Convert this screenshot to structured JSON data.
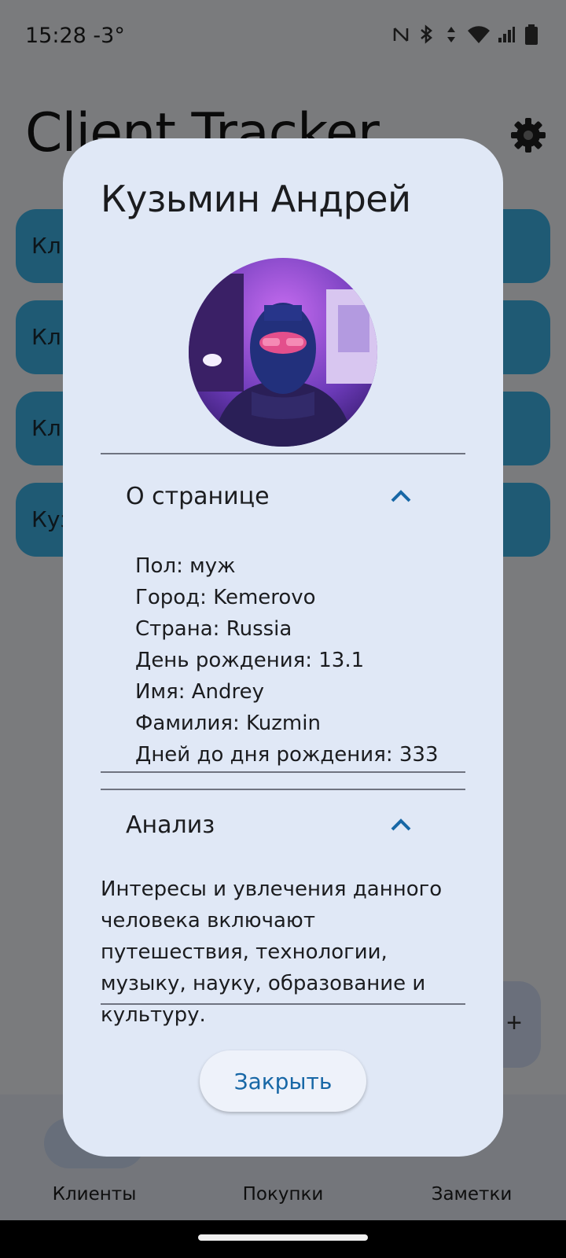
{
  "status": {
    "time": "15:28",
    "temperature": "-3°"
  },
  "app": {
    "title": "Client Tracker",
    "clients": [
      "Кли",
      "Кли",
      "Кли",
      "Куз"
    ]
  },
  "nav": {
    "items": [
      "Клиенты",
      "Покупки",
      "Заметки"
    ]
  },
  "dialog": {
    "title": "Кузьмин Андрей",
    "about": {
      "header": "О странице",
      "lines": [
        {
          "key": "Пол:",
          "value": "муж"
        },
        {
          "key": "Город:",
          "value": "Kemerovo"
        },
        {
          "key": "Страна:",
          "value": "Russia"
        },
        {
          "key": "День рождения:",
          "value": "13.1"
        },
        {
          "key": "Имя:",
          "value": "Andrey"
        },
        {
          "key": "Фамилия:",
          "value": "Kuzmin"
        },
        {
          "key": "Дней до дня рождения:",
          "value": "333"
        }
      ]
    },
    "analysis": {
      "header": "Анализ",
      "text": "Интересы и увлечения данного человека включают путешествия, технологии, музыку, науку, образование и культуру."
    },
    "close_label": "Закрыть"
  },
  "colors": {
    "accent": "#1767a6",
    "card": "#3fb4e8",
    "dialog_bg": "#e0e8f6"
  }
}
